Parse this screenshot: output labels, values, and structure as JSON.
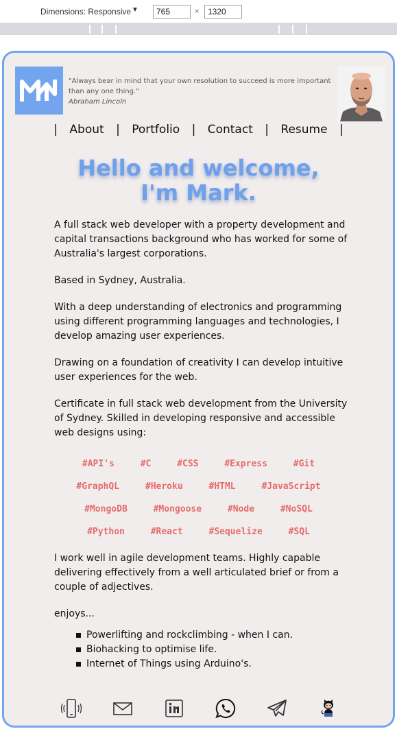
{
  "devtools": {
    "dimensions_label": "Dimensions: Responsive",
    "width_value": "765",
    "times": "×",
    "height_value": "1320"
  },
  "header": {
    "logo_icon": "mw-monogram-icon",
    "quote_text": "\"Always bear in mind that your own resolution to succeed is more important than any one thing.\"",
    "quote_author": "Abraham Lincoln",
    "portrait_icon": "profile-photo"
  },
  "nav": {
    "separator": "|",
    "items": [
      {
        "label": "About"
      },
      {
        "label": "Portfolio"
      },
      {
        "label": "Contact"
      },
      {
        "label": "Resume"
      }
    ]
  },
  "hero": {
    "line1": "Hello and welcome,",
    "line2": "I'm Mark."
  },
  "about": {
    "paragraphs": [
      "A full stack web developer with a property development and capital transactions background who has worked for some of Australia's largest corporations.",
      "Based in Sydney, Australia.",
      "With a deep understanding of electronics and programming using different programming languages and technologies, I develop amazing user experiences.",
      "Drawing on a foundation of creativity I can develop intuitive user experiences for the web.",
      "Certificate in full stack web development from the University of Sydney. Skilled in developing responsive and accessible web designs using:"
    ]
  },
  "tags": [
    [
      "#API's",
      "#C",
      "#CSS",
      "#Express",
      "#Git"
    ],
    [
      "#GraphQL",
      "#Heroku",
      "#HTML",
      "#JavaScript"
    ],
    [
      "#MongoDB",
      "#Mongoose",
      "#Node",
      "#NoSQL"
    ],
    [
      "#Python",
      "#React",
      "#Sequelize",
      "#SQL"
    ]
  ],
  "closing": {
    "agile": "I work well in agile development teams. Highly capable delivering effectively from a well articulated brief or from a couple of adjectives.",
    "enjoys_label": "enjoys...",
    "enjoys": [
      "Powerlifting and rockclimbing - when I can.",
      "Biohacking to optimise life.",
      "Internet of Things using Arduino's."
    ]
  },
  "social": [
    {
      "icon": "phone-icon"
    },
    {
      "icon": "email-icon"
    },
    {
      "icon": "linkedin-icon"
    },
    {
      "icon": "whatsapp-icon"
    },
    {
      "icon": "telegram-icon"
    },
    {
      "icon": "github-icon"
    }
  ],
  "colors": {
    "accent": "#73a5ee",
    "background": "#f2eded",
    "tag": "#e56b6b"
  }
}
